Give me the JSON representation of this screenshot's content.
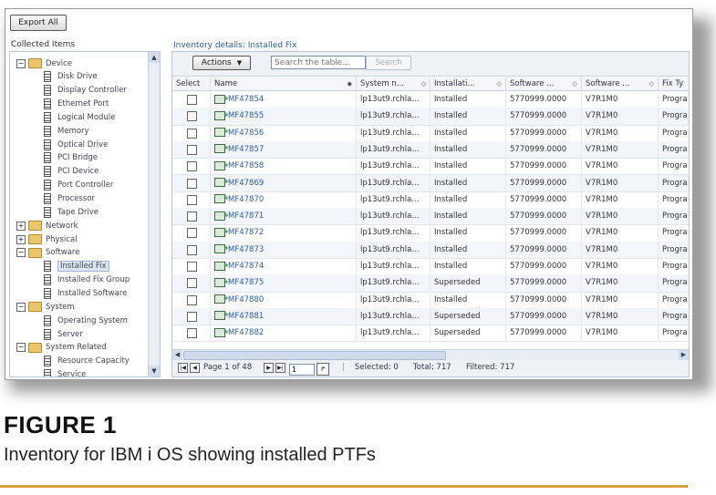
{
  "toolbar": {
    "export_label": "Export All"
  },
  "left_panel": {
    "title": "Collected Items",
    "tree": [
      {
        "label": "Device",
        "type": "folder",
        "expander": "−",
        "level": 0
      },
      {
        "label": "Disk Drive",
        "type": "doc",
        "level": 1
      },
      {
        "label": "Display Controller",
        "type": "doc",
        "level": 1
      },
      {
        "label": "Ethernet Port",
        "type": "doc",
        "level": 1
      },
      {
        "label": "Logical Module",
        "type": "doc",
        "level": 1
      },
      {
        "label": "Memory",
        "type": "doc",
        "level": 1
      },
      {
        "label": "Optical Drive",
        "type": "doc",
        "level": 1
      },
      {
        "label": "PCI Bridge",
        "type": "doc",
        "level": 1
      },
      {
        "label": "PCI Device",
        "type": "doc",
        "level": 1
      },
      {
        "label": "Port Controller",
        "type": "doc",
        "level": 1
      },
      {
        "label": "Processor",
        "type": "doc",
        "level": 1
      },
      {
        "label": "Tape Drive",
        "type": "doc",
        "level": 1
      },
      {
        "label": "Network",
        "type": "folder",
        "expander": "+",
        "level": 0
      },
      {
        "label": "Physical",
        "type": "folder",
        "expander": "+",
        "level": 0
      },
      {
        "label": "Software",
        "type": "folder",
        "expander": "−",
        "level": 0
      },
      {
        "label": "Installed Fix",
        "type": "doc",
        "level": 1,
        "selected": true
      },
      {
        "label": "Installed Fix Group",
        "type": "doc",
        "level": 1
      },
      {
        "label": "Installed Software",
        "type": "doc",
        "level": 1
      },
      {
        "label": "System",
        "type": "folder",
        "expander": "−",
        "level": 0
      },
      {
        "label": "Operating System",
        "type": "doc",
        "level": 1
      },
      {
        "label": "Server",
        "type": "doc",
        "level": 1
      },
      {
        "label": "System Related",
        "type": "folder",
        "expander": "−",
        "level": 0
      },
      {
        "label": "Resource Capacity",
        "type": "doc",
        "level": 1
      },
      {
        "label": "Service",
        "type": "doc",
        "level": 1
      }
    ]
  },
  "details": {
    "title": "Inventory details: Installed Fix",
    "actions_label": "Actions",
    "search_placeholder": "Search the table...",
    "search_button": "Search",
    "columns": [
      "Select",
      "Name",
      "System n...",
      "Installati...",
      "Software ...",
      "Software ...",
      "Fix Ty"
    ],
    "rows": [
      {
        "name": "MF47854",
        "system": "lp13ut9.rchla...",
        "status": "Installed",
        "software": "5770999.0000",
        "release": "V7R1M0",
        "fixtype": "Progra"
      },
      {
        "name": "MF47855",
        "system": "lp13ut9.rchla...",
        "status": "Installed",
        "software": "5770999.0000",
        "release": "V7R1M0",
        "fixtype": "Progra"
      },
      {
        "name": "MF47856",
        "system": "lp13ut9.rchla...",
        "status": "Installed",
        "software": "5770999.0000",
        "release": "V7R1M0",
        "fixtype": "Progra"
      },
      {
        "name": "MF47857",
        "system": "lp13ut9.rchla...",
        "status": "Installed",
        "software": "5770999.0000",
        "release": "V7R1M0",
        "fixtype": "Progra"
      },
      {
        "name": "MF47858",
        "system": "lp13ut9.rchla...",
        "status": "Installed",
        "software": "5770999.0000",
        "release": "V7R1M0",
        "fixtype": "Progra"
      },
      {
        "name": "MF47869",
        "system": "lp13ut9.rchla...",
        "status": "Installed",
        "software": "5770999.0000",
        "release": "V7R1M0",
        "fixtype": "Progra"
      },
      {
        "name": "MF47870",
        "system": "lp13ut9.rchla...",
        "status": "Installed",
        "software": "5770999.0000",
        "release": "V7R1M0",
        "fixtype": "Progra"
      },
      {
        "name": "MF47871",
        "system": "lp13ut9.rchla...",
        "status": "Installed",
        "software": "5770999.0000",
        "release": "V7R1M0",
        "fixtype": "Progra"
      },
      {
        "name": "MF47872",
        "system": "lp13ut9.rchla...",
        "status": "Installed",
        "software": "5770999.0000",
        "release": "V7R1M0",
        "fixtype": "Progra"
      },
      {
        "name": "MF47873",
        "system": "lp13ut9.rchla...",
        "status": "Installed",
        "software": "5770999.0000",
        "release": "V7R1M0",
        "fixtype": "Progra"
      },
      {
        "name": "MF47874",
        "system": "lp13ut9.rchla...",
        "status": "Installed",
        "software": "5770999.0000",
        "release": "V7R1M0",
        "fixtype": "Progra"
      },
      {
        "name": "MF47875",
        "system": "lp13ut9.rchla...",
        "status": "Superseded",
        "software": "5770999.0000",
        "release": "V7R1M0",
        "fixtype": "Progra"
      },
      {
        "name": "MF47880",
        "system": "lp13ut9.rchla...",
        "status": "Installed",
        "software": "5770999.0000",
        "release": "V7R1M0",
        "fixtype": "Progra"
      },
      {
        "name": "MF47881",
        "system": "lp13ut9.rchla...",
        "status": "Superseded",
        "software": "5770999.0000",
        "release": "V7R1M0",
        "fixtype": "Progra"
      },
      {
        "name": "MF47882",
        "system": "lp13ut9.rchla...",
        "status": "Superseded",
        "software": "5770999.0000",
        "release": "V7R1M0",
        "fixtype": "Progra"
      }
    ],
    "pager": {
      "page_text": "Page 1 of 48",
      "page_value": "1",
      "selected": "Selected: 0",
      "total": "Total: 717",
      "filtered": "Filtered: 717"
    }
  },
  "figure": {
    "title": "FIGURE 1",
    "caption": "Inventory for IBM i OS showing installed PTFs"
  },
  "colors": {
    "link": "#2b5ea7",
    "accent_rule": "#d4a23a"
  }
}
